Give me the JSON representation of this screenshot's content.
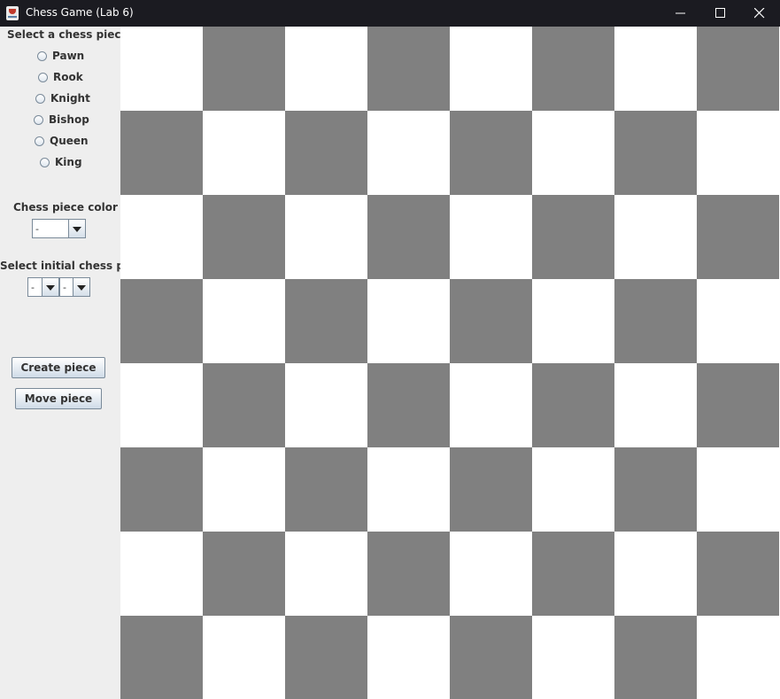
{
  "window": {
    "title": "Chess Game (Lab 6)",
    "icon": "java-cup-icon",
    "controls": [
      "minimize-icon",
      "maximize-icon",
      "close-icon"
    ]
  },
  "panel": {
    "piece_heading": "Select a chess piece",
    "pieces": [
      {
        "label": "Pawn",
        "selected": false
      },
      {
        "label": "Rook",
        "selected": false
      },
      {
        "label": "Knight",
        "selected": false
      },
      {
        "label": "Bishop",
        "selected": false
      },
      {
        "label": "Queen",
        "selected": false
      },
      {
        "label": "King",
        "selected": false
      }
    ],
    "color_heading": "Chess piece color",
    "color_value": "-",
    "pos_heading": "Select initial chess pos.",
    "pos_col_value": "-",
    "pos_row_value": "-",
    "create_label": "Create piece",
    "move_label": "Move piece"
  },
  "board": {
    "rows": 8,
    "cols": 8,
    "light_color": "#ffffff",
    "dark_color": "#808080",
    "top_left": "light"
  }
}
